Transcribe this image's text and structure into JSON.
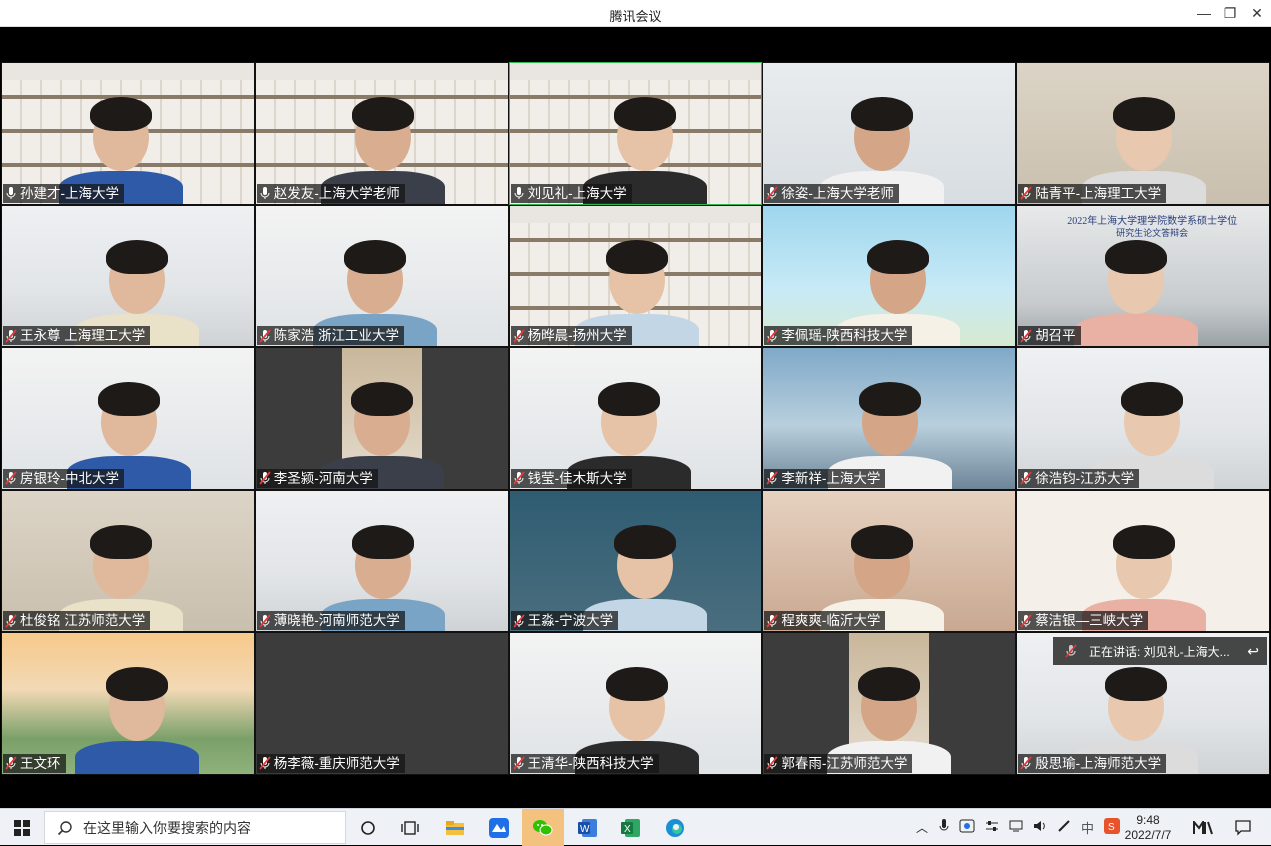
{
  "window": {
    "title": "腾讯会议",
    "controls": {
      "minimize": "—",
      "restore": "❐",
      "close": "✕"
    }
  },
  "participants": [
    {
      "name": "孙建才-上海大学",
      "mic": "unmuted",
      "bg": "shelf"
    },
    {
      "name": "赵发友-上海大学老师",
      "mic": "unmuted",
      "bg": "shelf"
    },
    {
      "name": "刘见礼-上海大学",
      "mic": "unmuted",
      "bg": "shelf",
      "active": true
    },
    {
      "name": "徐姿-上海大学老师",
      "mic": "muted",
      "bg": "blue"
    },
    {
      "name": "陆青平-上海理工大学",
      "mic": "muted",
      "bg": "room"
    },
    {
      "name": "王永尊 上海理工大学",
      "mic": "muted",
      "bg": "office"
    },
    {
      "name": "陈家浩 浙江工业大学",
      "mic": "muted",
      "bg": "white"
    },
    {
      "name": "杨晔晨-扬州大学",
      "mic": "muted",
      "bg": "shelf"
    },
    {
      "name": "李佩瑶-陕西科技大学",
      "mic": "muted",
      "bg": "cartoon"
    },
    {
      "name": "胡召平",
      "mic": "muted",
      "bg": "campus",
      "poster_title": "2022年上海大学理学院数学系硕士学位",
      "poster_subtitle": "研究生论文答辩会"
    },
    {
      "name": "房银玲-中北大学",
      "mic": "muted",
      "bg": "white"
    },
    {
      "name": "李圣颍-河南大学",
      "mic": "muted",
      "bg": "dark"
    },
    {
      "name": "钱莹-佳木斯大学",
      "mic": "muted",
      "bg": "white"
    },
    {
      "name": "李新祥-上海大学",
      "mic": "muted",
      "bg": "sky"
    },
    {
      "name": "徐浩钧-江苏大学",
      "mic": "muted",
      "bg": "office"
    },
    {
      "name": "杜俊铭 江苏师范大学",
      "mic": "muted",
      "bg": "room"
    },
    {
      "name": "薄晓艳-河南师范大学",
      "mic": "muted",
      "bg": "office"
    },
    {
      "name": "王淼-宁波大学",
      "mic": "muted",
      "bg": "green"
    },
    {
      "name": "程爽爽-临沂大学",
      "mic": "muted",
      "bg": "warm"
    },
    {
      "name": "蔡洁银—三峡大学",
      "mic": "muted",
      "bg": "poster"
    },
    {
      "name": "王文环",
      "mic": "muted",
      "bg": "school"
    },
    {
      "name": "杨李薇-重庆师范大学",
      "mic": "muted",
      "bg": "dark",
      "video_off": true
    },
    {
      "name": "王清华-陕西科技大学",
      "mic": "muted",
      "bg": "white"
    },
    {
      "name": "郭春雨-江苏师范大学",
      "mic": "muted",
      "bg": "dark"
    },
    {
      "name": "殷思瑜-上海师范大学",
      "mic": "muted",
      "bg": "office"
    }
  ],
  "speaking": {
    "text": "正在讲话: 刘见礼-上海大..."
  },
  "taskbar": {
    "search_placeholder": "在这里输入你要搜索的内容",
    "time": "9:48",
    "date": "2022/7/7",
    "ime_label": "中"
  },
  "colors": {
    "active_border": "#2db84d",
    "muted_mic": "#e23b3b",
    "unmuted_mic": "#ffffff"
  }
}
